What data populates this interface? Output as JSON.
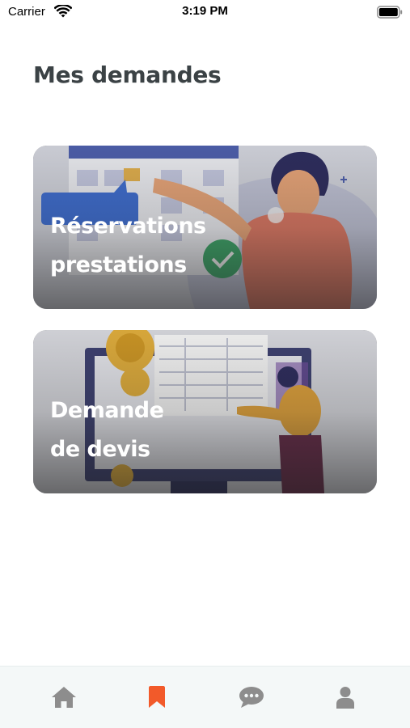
{
  "status_bar": {
    "carrier": "Carrier",
    "time": "3:19 PM"
  },
  "page": {
    "title": "Mes demandes"
  },
  "cards": [
    {
      "line1": "Réservations",
      "line2": "prestations"
    },
    {
      "line1": "Demande",
      "line2": "de devis"
    }
  ],
  "tab_bar": {
    "items": [
      {
        "icon": "home-icon",
        "active": false
      },
      {
        "icon": "bookmark-icon",
        "active": true
      },
      {
        "icon": "chat-bubble-icon",
        "active": false
      },
      {
        "icon": "user-icon",
        "active": false
      }
    ],
    "active_color": "#f25a2a",
    "inactive_color": "#8d8d8d"
  },
  "colors": {
    "title": "#3b4245",
    "background": "#ffffff",
    "tab_bar_background": "#f4f8f8"
  }
}
